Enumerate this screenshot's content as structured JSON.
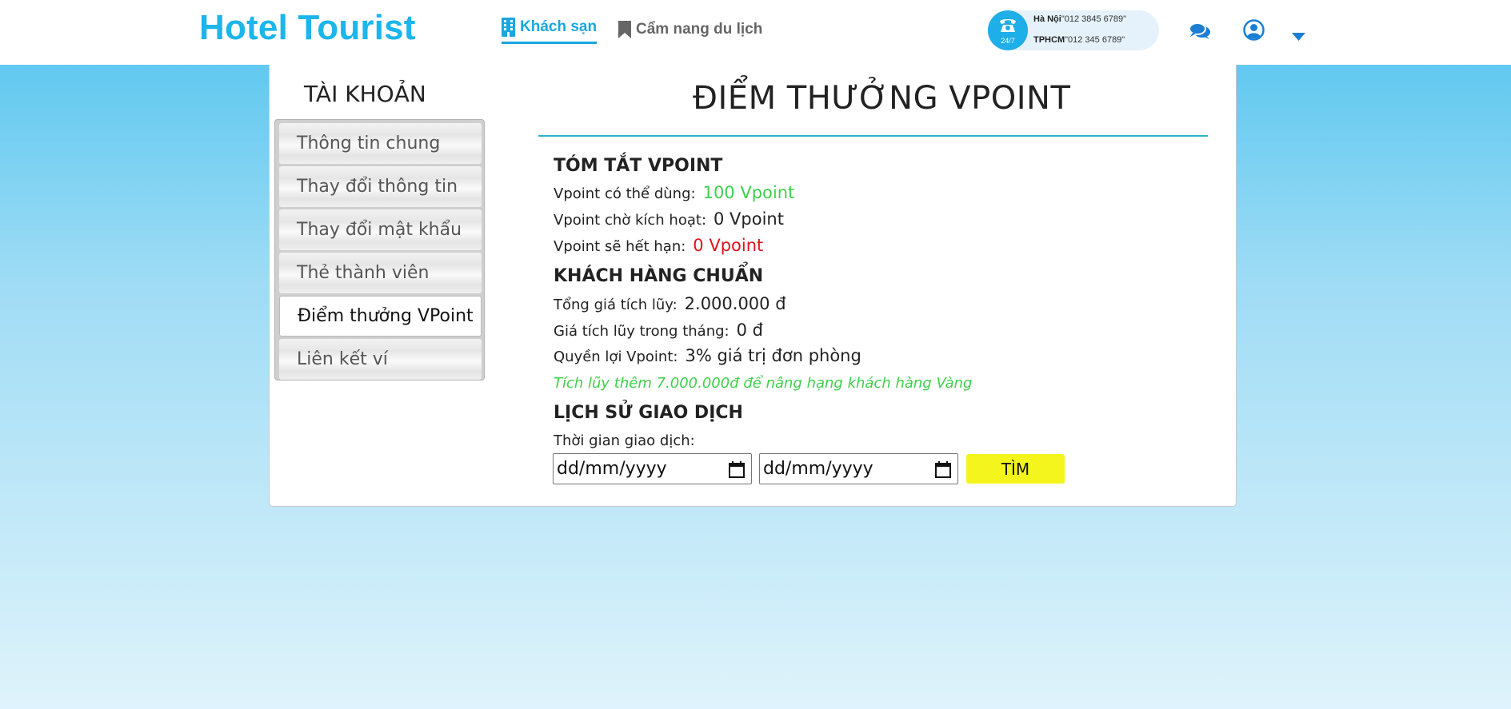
{
  "header": {
    "logo": "Hotel Tourist",
    "nav": [
      {
        "label": "Khách sạn",
        "icon": "building-icon",
        "active": true
      },
      {
        "label": "Cẩm nang du lịch",
        "icon": "bookmark-icon",
        "active": false
      }
    ],
    "hotline": {
      "badge": "24/7",
      "lines": [
        {
          "city": "Hà Nội",
          "phone": "\"012 3845 6789\""
        },
        {
          "city": "TPHCM",
          "phone": "\"012 345 6789\""
        }
      ]
    },
    "icons": [
      "comments-icon",
      "user-circle-icon",
      "caret-down-icon"
    ]
  },
  "sidebar": {
    "title": "TÀI KHOẢN",
    "items": [
      {
        "label": "Thông tin chung",
        "active": false
      },
      {
        "label": "Thay đổi thông tin",
        "active": false
      },
      {
        "label": "Thay đổi mật khẩu",
        "active": false
      },
      {
        "label": "Thẻ thành viên",
        "active": false
      },
      {
        "label": "Điểm thưởng VPoint",
        "active": true
      },
      {
        "label": "Liên kết ví",
        "active": false
      }
    ]
  },
  "main": {
    "title": "ĐIỂM THƯỞNG VPOINT",
    "summary": {
      "heading": "TÓM TẮT VPOINT",
      "available_label": "Vpoint có thể dùng:",
      "available_value": "100 Vpoint",
      "pending_label": "Vpoint chờ kích hoạt:",
      "pending_value": "0 Vpoint",
      "expiring_label": "Vpoint sẽ hết hạn:",
      "expiring_value": "0 Vpoint"
    },
    "customer": {
      "heading": "KHÁCH HÀNG CHUẨN",
      "total_label": "Tổng giá tích lũy:",
      "total_value": "2.000.000 đ",
      "month_label": "Giá tích lũy trong tháng:",
      "month_value": "0 đ",
      "benefit_label": "Quyền lợi Vpoint:",
      "benefit_value": "3% giá trị đơn phòng",
      "upgrade_note": "Tích lũy thêm 7.000.000đ để nâng hạng khách hàng Vàng"
    },
    "history": {
      "heading": "LỊCH SỬ GIAO DỊCH",
      "time_label": "Thời gian giao dịch:",
      "from_placeholder": "dd/mm/yyyy",
      "to_placeholder": "dd/mm/yyyy",
      "search_label": "TÌM"
    }
  },
  "colors": {
    "brand": "#1cb5ec",
    "positive": "#3fd04b",
    "negative": "#e0121d",
    "button": "#f5f51e",
    "divider": "#27b4c6"
  }
}
